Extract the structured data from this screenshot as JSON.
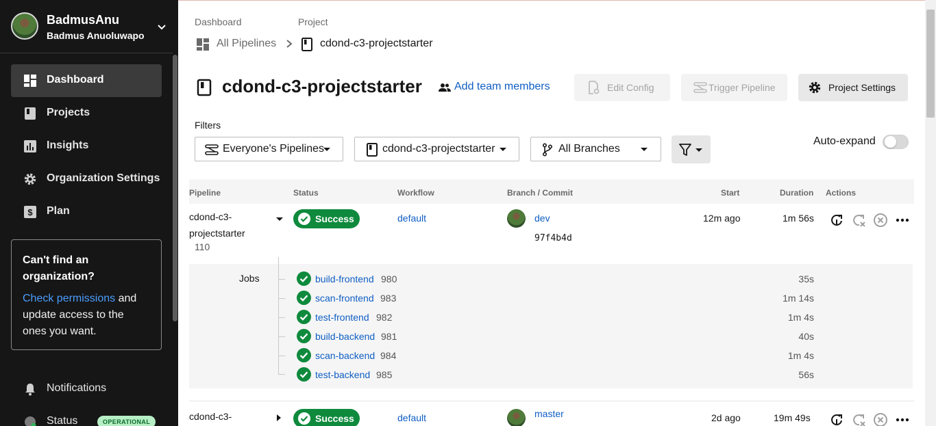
{
  "user": {
    "username": "BadmusAnu",
    "full_name": "Badmus Anuoluwapo"
  },
  "sidebar": {
    "items": [
      {
        "label": "Dashboard",
        "icon": "dashboard-icon",
        "active": true
      },
      {
        "label": "Projects",
        "icon": "projects-icon"
      },
      {
        "label": "Insights",
        "icon": "insights-icon"
      },
      {
        "label": "Organization Settings",
        "icon": "gear-icon"
      },
      {
        "label": "Plan",
        "icon": "plan-icon"
      }
    ],
    "org_card": {
      "title": "Can't find an organization?",
      "link": "Check permissions",
      "body": " and update access to the ones you want."
    },
    "notifications": "Notifications",
    "status": "Status",
    "status_badge": "OPERATIONAL"
  },
  "breadcrumb": {
    "dashboard": "Dashboard",
    "project": "Project",
    "all_pipelines": "All Pipelines",
    "project_name": "cdond-c3-projectstarter"
  },
  "header": {
    "title": "cdond-c3-projectstarter",
    "add_team": "Add team members",
    "edit_config": "Edit Config",
    "trigger_pipeline": "Trigger Pipeline",
    "project_settings": "Project Settings"
  },
  "filters": {
    "label": "Filters",
    "pipelines": "Everyone's Pipelines",
    "project": "cdond-c3-projectstarter",
    "branches": "All Branches",
    "auto_expand": "Auto-expand",
    "auto_expand_on": false
  },
  "table": {
    "columns": [
      "Pipeline",
      "Status",
      "Workflow",
      "Branch / Commit",
      "Start",
      "Duration",
      "Actions"
    ],
    "rows": [
      {
        "pipeline_line1": "cdond-c3-",
        "pipeline_line2": "projectstarter",
        "number": "110",
        "status": "Success",
        "workflow": "default",
        "branch": "dev",
        "commit": "97f4b4d",
        "start": "12m ago",
        "duration": "1m 56s",
        "jobs_label": "Jobs",
        "jobs": [
          {
            "name": "build-frontend",
            "number": "980",
            "duration": "35s"
          },
          {
            "name": "scan-frontend",
            "number": "983",
            "duration": "1m 14s"
          },
          {
            "name": "test-frontend",
            "number": "982",
            "duration": "1m 4s"
          },
          {
            "name": "build-backend",
            "number": "981",
            "duration": "40s"
          },
          {
            "name": "scan-backend",
            "number": "984",
            "duration": "1m 4s"
          },
          {
            "name": "test-backend",
            "number": "985",
            "duration": "56s"
          }
        ]
      },
      {
        "pipeline_line1": "cdond-c3-",
        "status": "Success",
        "workflow": "default",
        "branch": "master",
        "start": "2d ago",
        "duration": "19m 49s"
      }
    ]
  },
  "colors": {
    "success": "#0f8a3d",
    "link": "#0f5ec4",
    "sidebar_bg": "#161616"
  }
}
